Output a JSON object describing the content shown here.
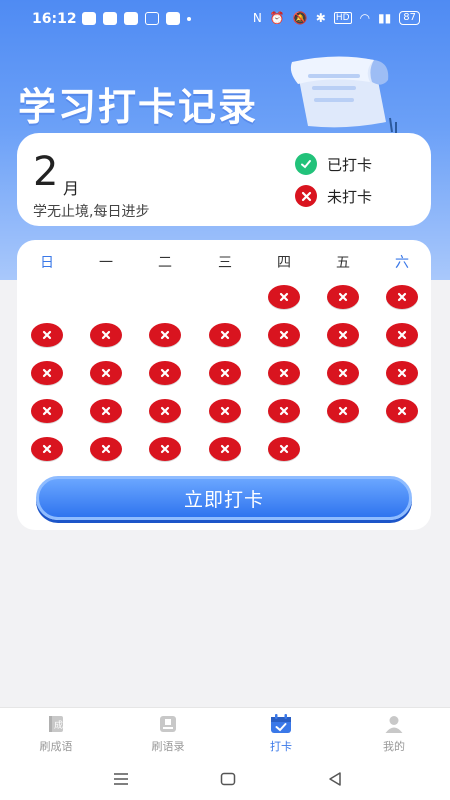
{
  "status_bar": {
    "time": "16:12",
    "left_icons": [
      "shield-app-icon",
      "message-app-icon",
      "mail-app-icon",
      "translate-app-icon",
      "telegram-app-icon"
    ],
    "right_icons": [
      "nfc-icon",
      "alarm-icon",
      "mute-icon",
      "bluetooth-icon",
      "hd-icon",
      "wifi-icon",
      "signal-icon"
    ],
    "battery": "87"
  },
  "header": {
    "title": "学习打卡记录"
  },
  "summary": {
    "month_number": "2",
    "month_unit": "月",
    "motto": "学无止境,每日进步",
    "legend": {
      "checked": "已打卡",
      "unchecked": "未打卡"
    }
  },
  "calendar": {
    "weekdays": [
      "日",
      "一",
      "二",
      "三",
      "四",
      "五",
      "六"
    ],
    "first_weekday_index": 4,
    "days": 29,
    "checked_days": [],
    "colors": {
      "checked": "#22c27a",
      "unchecked": "#d9141f",
      "weekend": "#3a78e8"
    }
  },
  "checkin_button": {
    "label": "立即打卡"
  },
  "tabs": [
    {
      "label": "刷成语",
      "icon": "book-icon",
      "active": false
    },
    {
      "label": "刷语录",
      "icon": "notebook-icon",
      "active": false
    },
    {
      "label": "打卡",
      "icon": "calendar-check-icon",
      "active": true
    },
    {
      "label": "我的",
      "icon": "user-icon",
      "active": false
    }
  ],
  "system_nav": [
    "menu-icon",
    "home-icon",
    "back-icon"
  ]
}
